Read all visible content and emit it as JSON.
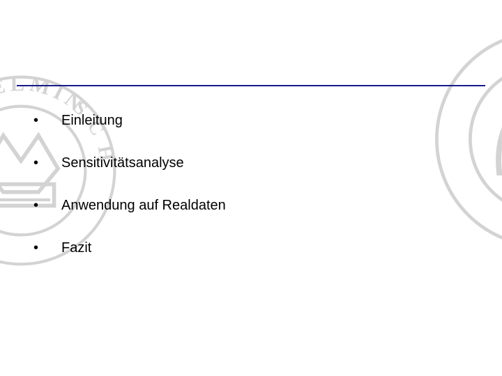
{
  "bullets": {
    "items": [
      {
        "label": "Einleitung"
      },
      {
        "label": "Sensitivitätsanalyse"
      },
      {
        "label": "Anwendung auf Realdaten"
      },
      {
        "label": "Fazit"
      }
    ],
    "marker": "•"
  }
}
